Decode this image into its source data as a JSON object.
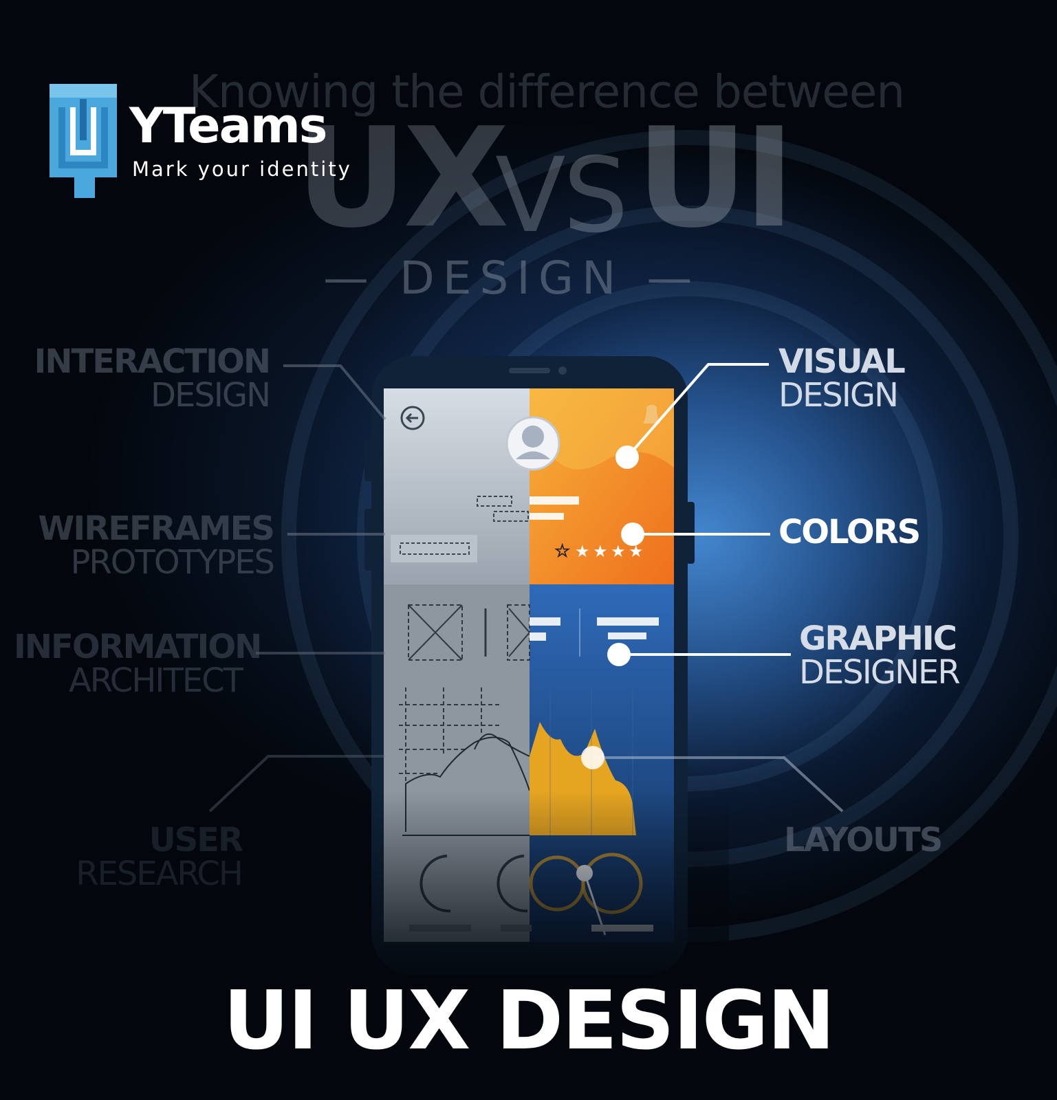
{
  "brand": {
    "name": "YTeams",
    "tagline": "Mark your identity",
    "logo_color": "#4aa8dd"
  },
  "poster": {
    "headline": "Knowing the difference between",
    "ux": "UX",
    "vs": "VS",
    "ui": "UI",
    "design": "— DESIGN —"
  },
  "labels_left": [
    {
      "line1": "INTERACTION",
      "line2": "DESIGN"
    },
    {
      "line1": "WIREFRAMES",
      "line2": "PROTOTYPES"
    },
    {
      "line1": "INFORMATION",
      "line2": "ARCHITECT"
    },
    {
      "line1": "USER",
      "line2": "RESEARCH"
    }
  ],
  "labels_right": [
    {
      "line1": "VISUAL",
      "line2": "DESIGN"
    },
    {
      "line1": "COLORS",
      "line2": ""
    },
    {
      "line1": "GRAPHIC",
      "line2": "DESIGNER"
    },
    {
      "line1": "LAYOUTS",
      "line2": ""
    }
  ],
  "title": "UI UX DESIGN",
  "colors": {
    "background": "#03070d",
    "glow": "#468cd7",
    "orange": "#f39a1e",
    "blue_panel": "#2b65b3",
    "text": "#ffffff"
  }
}
